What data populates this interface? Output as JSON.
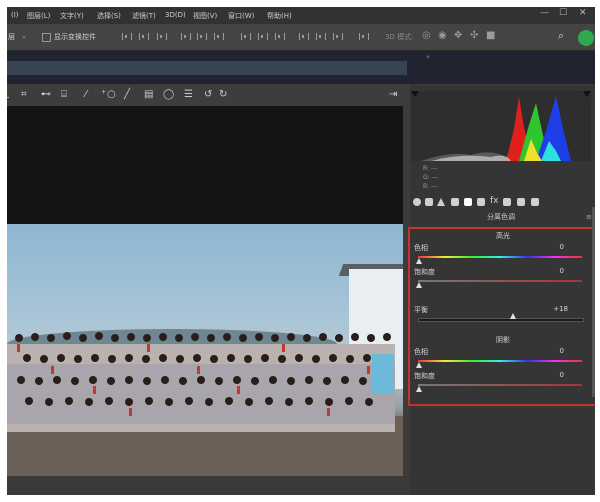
{
  "menubar": {
    "items": [
      "(I)",
      "图层(L)",
      "文字(Y)",
      "选择(S)",
      "滤镜(T)",
      "3D(D)",
      "视图(V)",
      "窗口(W)",
      "帮助(H)"
    ],
    "min": "—",
    "max": "☐",
    "close": "✕"
  },
  "optbar": {
    "dropdown": "层",
    "checkbox_label": "显示变换控件",
    "mode3d": "3D 模式:"
  },
  "camera_raw": {
    "histogram": {
      "r": "R: ---",
      "g": "G: ---",
      "b": "B: ---"
    },
    "section_title": "分离色调",
    "highlights": {
      "title": "高光",
      "hue_label": "色相",
      "hue_value": "0",
      "sat_label": "饱和度",
      "sat_value": "0"
    },
    "balance": {
      "label": "平衡",
      "value": "+18"
    },
    "shadows": {
      "title": "阴影",
      "hue_label": "色相",
      "hue_value": "0",
      "sat_label": "饱和度",
      "sat_value": "0"
    }
  },
  "colors": {
    "highlight_box": "#c8322c",
    "accent_green": "#2fa84f"
  }
}
